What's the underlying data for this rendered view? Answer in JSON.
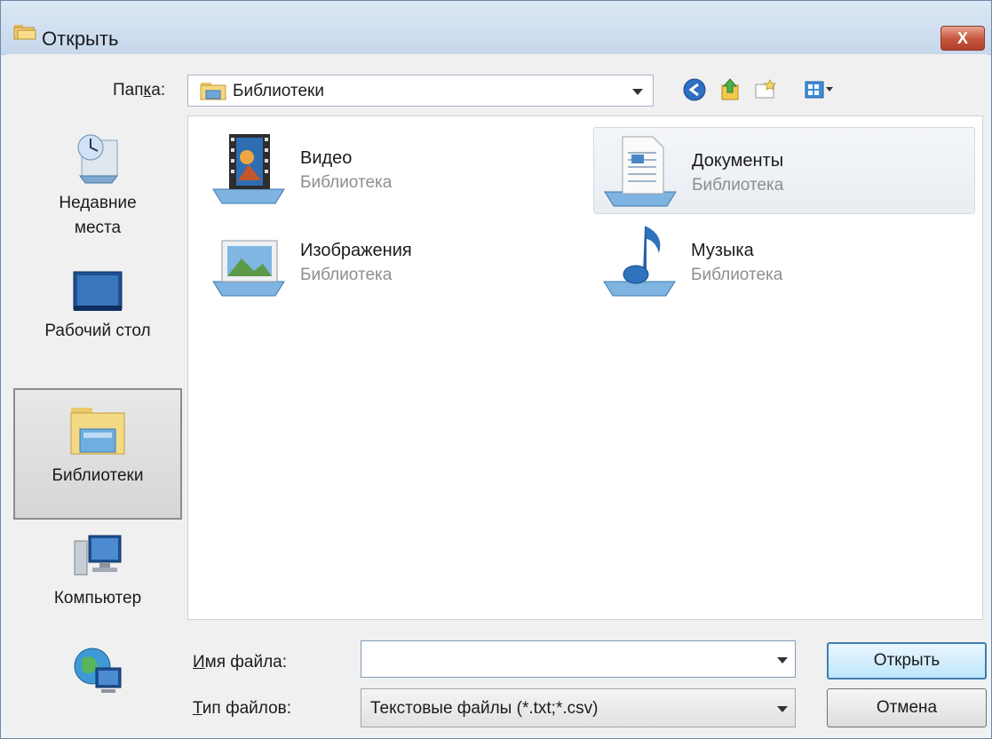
{
  "window": {
    "title": "Открыть",
    "close_label": "X"
  },
  "toolbar": {
    "lookin_label_pre": "Пап",
    "lookin_label_accel": "к",
    "lookin_label_post": "а:",
    "lookin_value": "Библиотеки",
    "icons": [
      "back-icon",
      "up-folder-icon",
      "new-folder-icon",
      "view-menu-icon"
    ]
  },
  "places": [
    {
      "label": "Недавние места",
      "icon": "recent-places-icon"
    },
    {
      "label": "Рабочий стол",
      "icon": "desktop-icon"
    },
    {
      "label": "Библиотеки",
      "icon": "libraries-icon",
      "selected": true
    },
    {
      "label": "Компьютер",
      "icon": "computer-icon"
    },
    {
      "label": "",
      "icon": "network-icon"
    }
  ],
  "items": [
    {
      "name": "Видео",
      "type": "Библиотека",
      "icon": "video-library-icon"
    },
    {
      "name": "Документы",
      "type": "Библиотека",
      "icon": "documents-library-icon"
    },
    {
      "name": "Изображения",
      "type": "Библиотека",
      "icon": "pictures-library-icon"
    },
    {
      "name": "Музыка",
      "type": "Библиотека",
      "icon": "music-library-icon"
    }
  ],
  "filename": {
    "label_accel": "И",
    "label_rest": "мя файла:",
    "value": ""
  },
  "filetype": {
    "label_accel": "Т",
    "label_rest": "ип файлов:",
    "value": "Текстовые файлы (*.txt;*.csv)"
  },
  "buttons": {
    "open": "Открыть",
    "cancel": "Отмена"
  }
}
